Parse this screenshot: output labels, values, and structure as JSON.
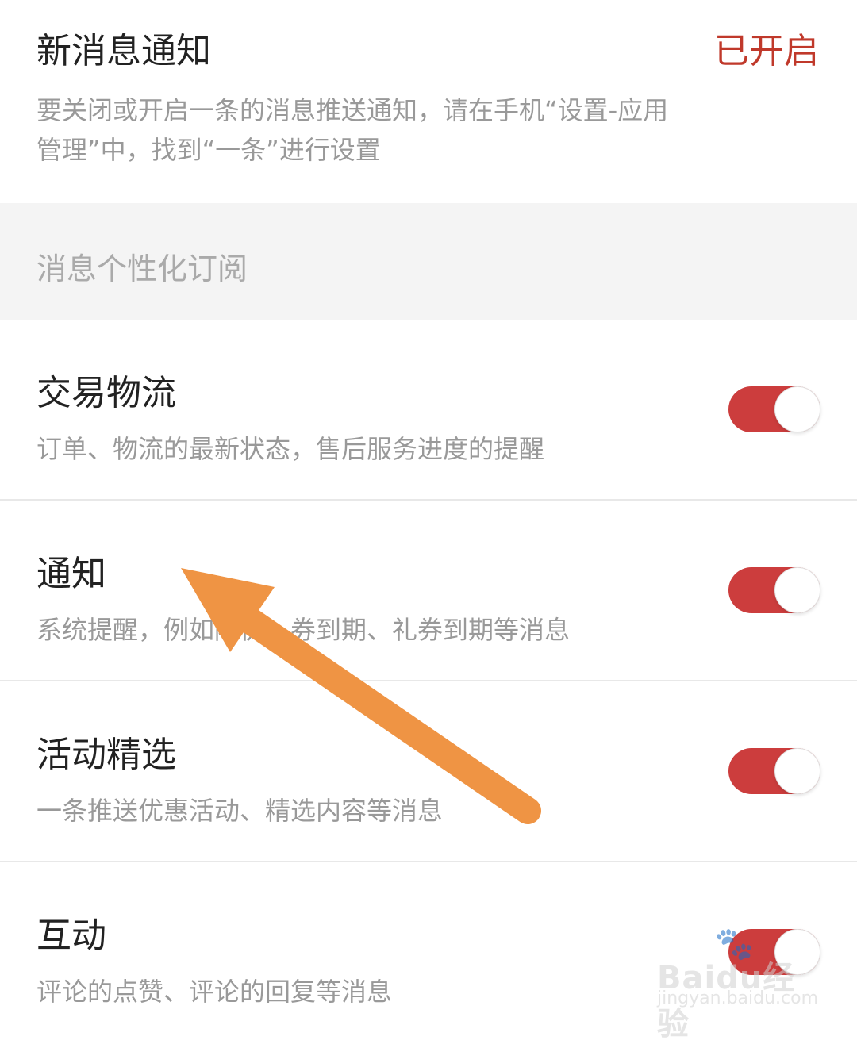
{
  "colors": {
    "accent": "#c0392b",
    "toggle_on": "#cc3d3d"
  },
  "notification": {
    "title": "新消息通知",
    "status": "已开启",
    "description": "要关闭或开启一条的消息推送通知，请在手机“设置-应用管理”中，找到“一条”进行设置"
  },
  "subscription": {
    "header": "消息个性化订阅",
    "items": [
      {
        "title": "交易物流",
        "description": "订单、物流的最新状态，售后服务进度的提醒",
        "enabled": true
      },
      {
        "title": "通知",
        "description": "系统提醒，例如降价、券到期、礼券到期等消息",
        "enabled": true
      },
      {
        "title": "活动精选",
        "description": "一条推送优惠活动、精选内容等消息",
        "enabled": true
      },
      {
        "title": "互动",
        "description": "评论的点赞、评论的回复等消息",
        "enabled": true
      }
    ]
  },
  "watermark": {
    "brand": "Baidu经验",
    "url": "jingyan.baidu.com"
  }
}
